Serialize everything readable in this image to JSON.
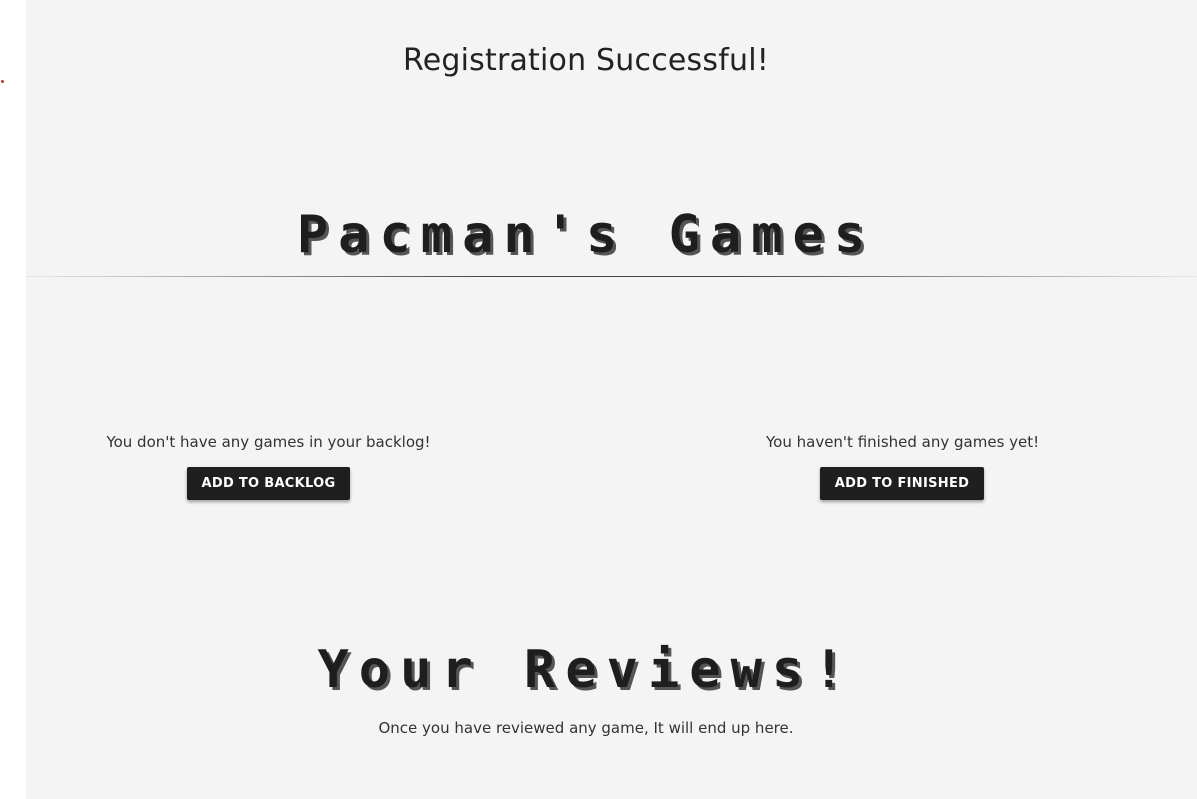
{
  "header": {
    "registration_message": "Registration Successful!"
  },
  "games_section": {
    "title": "Pacman's Games"
  },
  "backlog": {
    "empty_message": "You don't have any games in your backlog!",
    "button_label": "ADD TO BACKLOG"
  },
  "finished": {
    "empty_message": "You haven't finished any games yet!",
    "button_label": "ADD TO FINISHED"
  },
  "reviews_section": {
    "title": "Your Reviews!",
    "empty_message": "Once you have reviewed any game, It will end up here."
  },
  "colors": {
    "background": "#f4f4f4",
    "button_bg": "#1f1f1f",
    "button_text": "#ffffff",
    "accent_dot": "#c0392b"
  }
}
